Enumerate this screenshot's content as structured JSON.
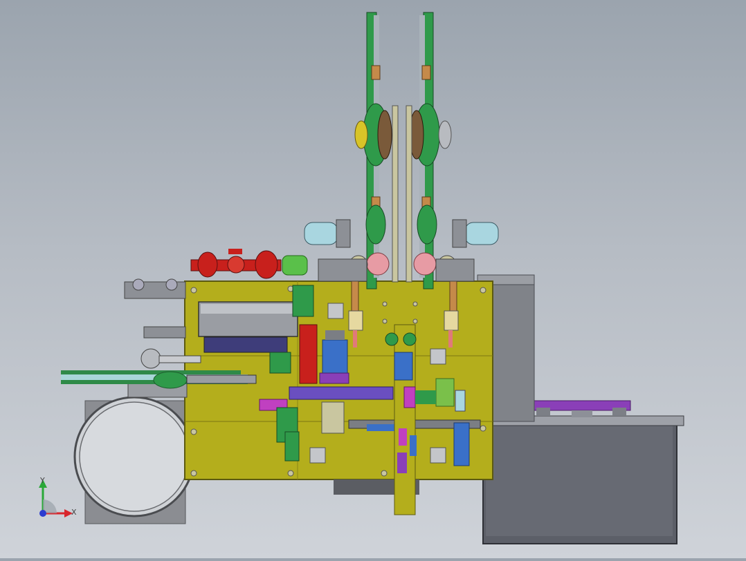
{
  "viewport": {
    "background_top": "#9ba4ae",
    "background_bottom": "#cfd3d9"
  },
  "triad": {
    "x_label": "X",
    "y_label": "Y",
    "x_color": "#d8262c",
    "y_color": "#2aa838",
    "z_color": "#2b3bd0"
  },
  "colors": {
    "base_plate": "#b4ae1c",
    "green_parts": "#2f9a4a",
    "red_handwheel": "#c8201c",
    "cyan_cylinder": "#a9d6e0",
    "purple_rails": "#8a3fb8",
    "gray_housing": "#7d7f86",
    "dark_bin": "#5c5f68"
  },
  "icons": [
    "axis-triad-icon"
  ]
}
